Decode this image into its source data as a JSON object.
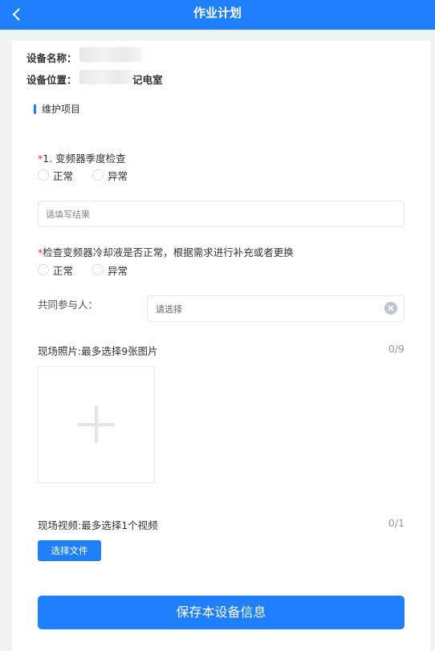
{
  "header": {
    "title": "作业计划",
    "back_icon": "chevron-left-icon"
  },
  "device": {
    "name_label": "设备名称：",
    "location_label": "设备位置：",
    "location_value_visible": "记电室"
  },
  "section": {
    "title": "维护项目"
  },
  "questions": [
    {
      "required_mark": "*",
      "text": "1. 变频器季度检查",
      "options": [
        "正常",
        "异常"
      ]
    },
    {
      "required_mark": "*",
      "text": "检查变频器冷却液是否正常，根据需求进行补充或者更换",
      "options": [
        "正常",
        "异常"
      ]
    }
  ],
  "result_input": {
    "placeholder": "请填写结果"
  },
  "participants": {
    "label": "共同参与人：",
    "placeholder": "请选择",
    "clear_icon": "clear-circle-icon"
  },
  "photos": {
    "label": "现场照片:最多选择9张图片",
    "count": "0/9",
    "add_icon": "plus-icon"
  },
  "video": {
    "label": "现场视频:最多选择1个视频",
    "count": "0/1",
    "button": "选择文件"
  },
  "save_button": "保存本设备信息",
  "colors": {
    "primary": "#1e80ff",
    "required": "#e8341c",
    "background": "#f2f3f5"
  }
}
